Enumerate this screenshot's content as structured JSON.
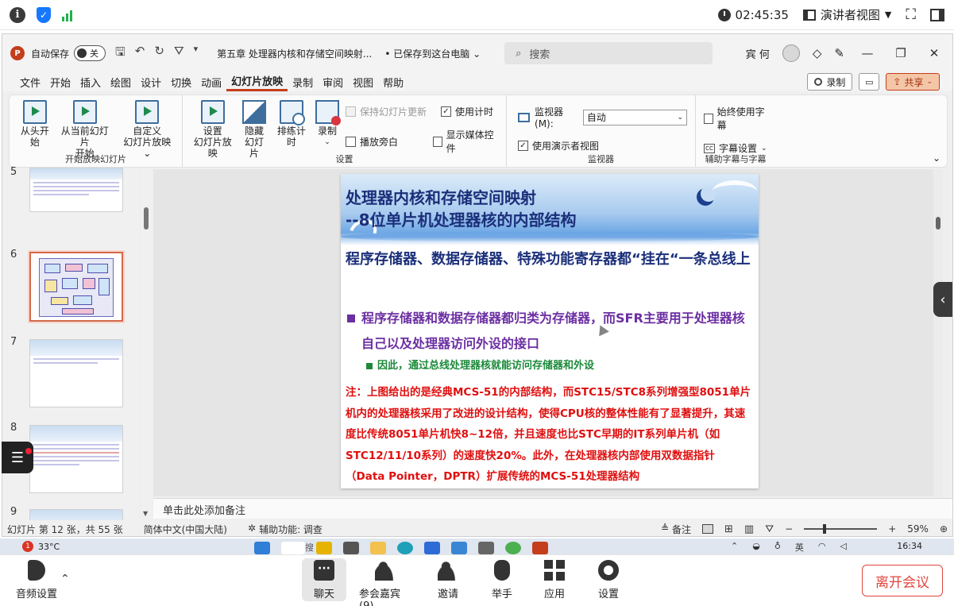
{
  "meeting_top": {
    "time": "02:45:35",
    "presenter_view": "演讲者视图"
  },
  "titlebar": {
    "autosave_label": "自动保存",
    "autosave_state": "关",
    "doc_title": "第五章 处理器内核和存储空间映射...",
    "save_status": "• 已保存到这台电脑",
    "search_placeholder": "搜索",
    "user": "宾 何"
  },
  "menu": {
    "items": [
      "文件",
      "开始",
      "插入",
      "绘图",
      "设计",
      "切换",
      "动画",
      "幻灯片放映",
      "录制",
      "审阅",
      "视图",
      "帮助"
    ],
    "active_index": 7,
    "record_button": "录制",
    "share_button": "共享"
  },
  "ribbon": {
    "start_group": {
      "from_beginning": "从头开始",
      "from_current_1": "从当前幻灯片",
      "from_current_2": "开始",
      "custom_1": "自定义",
      "custom_2": "幻灯片放映",
      "label": "开始放映幻灯片"
    },
    "setup_group": {
      "setup_1": "设置",
      "setup_2": "幻灯片放映",
      "hide_1": "隐藏",
      "hide_2": "幻灯片",
      "rehearse": "排练计时",
      "record": "录制",
      "keep_updated": "保持幻灯片更新",
      "use_timings": "使用计时",
      "play_narration": "播放旁白",
      "show_media": "显示媒体控件",
      "label": "设置"
    },
    "monitor_group": {
      "monitor_label": "监视器(M):",
      "monitor_value": "自动",
      "presenter_view": "使用演示者视图",
      "label": "监视器"
    },
    "caption_group": {
      "always_subtitles": "始终使用字幕",
      "subtitle_settings": "字幕设置",
      "label": "辅助字幕与字幕"
    }
  },
  "thumbnails": {
    "numbers": [
      "5",
      "6",
      "7",
      "8",
      "9"
    ]
  },
  "slide": {
    "title_line1": "处理器内核和存储空间映射",
    "title_line2": "--8位单片机处理器核的内部结构",
    "subtitle": "程序存储器、数据存储器、特殊功能寄存器都“挂在“一条总线上",
    "bullet1": "程序存储器和数据存储器都归类为存储器，而SFR主要用于处理器核自己以及处理器访问外设的接口",
    "bullet2": "因此，通过总线处理器核就能访问存储器和外设",
    "note": "注：上图给出的是经典MCS-51的内部结构，而STC15/STC8系列增强型8051单片机内的处理器核采用了改进的设计结构，使得CPU核的整体性能有了显著提升，其速度比传统8051单片机快8~12倍，并且速度也比STC早期的IT系列单片机（如STC12/11/10系列）的速度快20%。此外，在处理器核内部使用双数据指针（Data Pointer，DPTR）扩展传统的MCS-51处理器结构"
  },
  "notes_placeholder": "单击此处添加备注",
  "status": {
    "slide_info": "幻灯片 第 12 张，共 55 张",
    "language": "简体中文(中国大陆)",
    "accessibility": "辅助功能: 调查",
    "notes": "备注",
    "zoom": "59%"
  },
  "taskbar": {
    "temp": "33°C",
    "badge": "1",
    "search": "搜索",
    "lang": "英",
    "time": "16:34"
  },
  "meeting_bottom": {
    "audio": "音频设置",
    "chat": "聊天",
    "participants": "参会嘉宾(9)",
    "invite": "邀请",
    "raise_hand": "举手",
    "apps": "应用",
    "settings": "设置",
    "leave": "离开会议"
  },
  "colors": {
    "accent": "#c43e1c",
    "slide_title": "#1b2f7a",
    "bullet_purple": "#6b2fa2",
    "bullet_green": "#1c8a3b",
    "note_red": "#e00f0f",
    "leave_red": "#e0463c"
  }
}
